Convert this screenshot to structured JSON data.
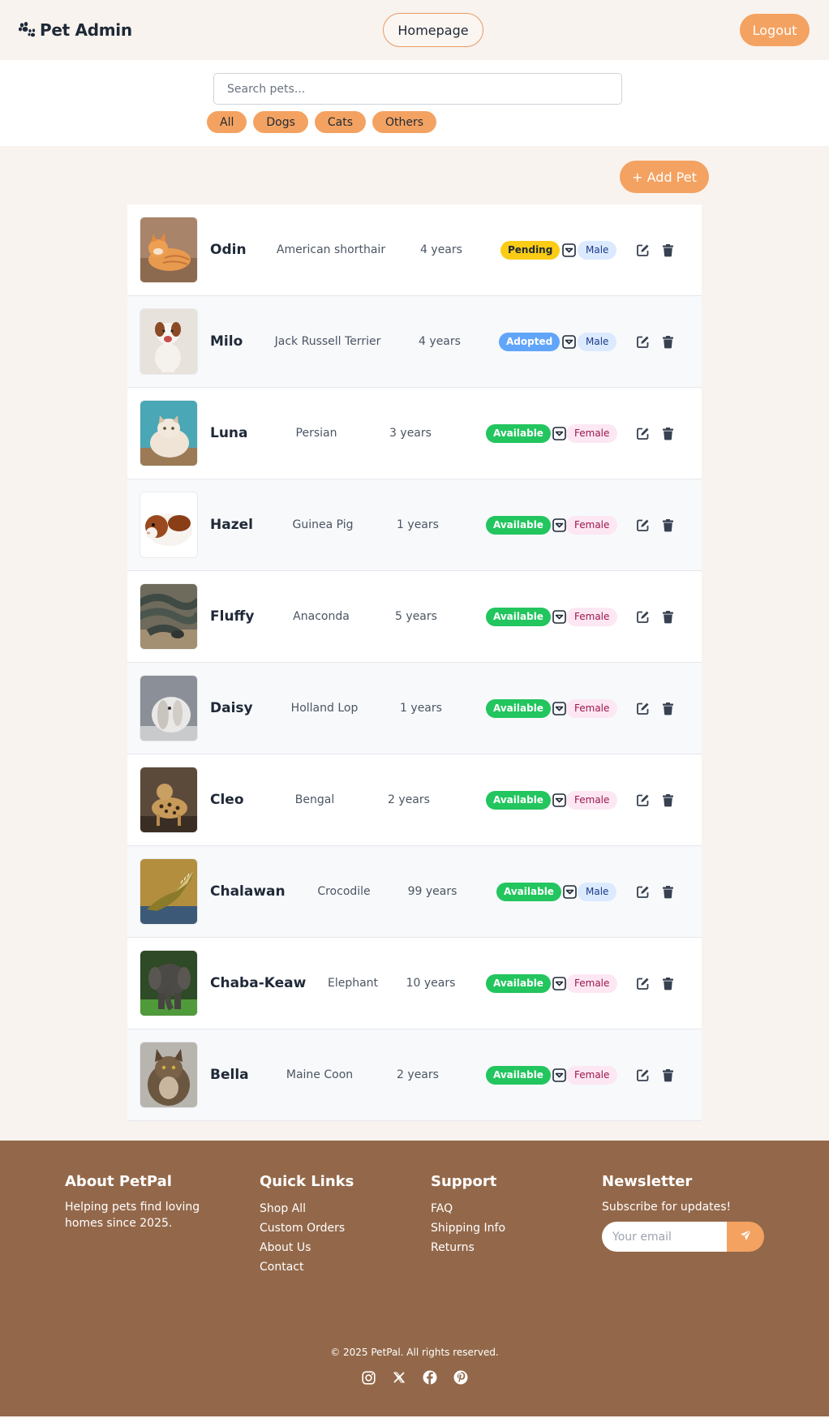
{
  "header": {
    "brand_title": "Pet Admin",
    "homepage_label": "Homepage",
    "logout_label": "Logout"
  },
  "search": {
    "placeholder": "Search pets...",
    "value": ""
  },
  "filters": [
    "All",
    "Dogs",
    "Cats",
    "Others"
  ],
  "add_pet_label": "+ Add Pet",
  "pets": [
    {
      "name": "Odin",
      "breed": "American shorthair",
      "age": "4 years",
      "status": "Pending",
      "gender": "Male"
    },
    {
      "name": "Milo",
      "breed": "Jack Russell Terrier",
      "age": "4 years",
      "status": "Adopted",
      "gender": "Male"
    },
    {
      "name": "Luna",
      "breed": "Persian",
      "age": "3 years",
      "status": "Available",
      "gender": "Female"
    },
    {
      "name": "Hazel",
      "breed": "Guinea Pig",
      "age": "1 years",
      "status": "Available",
      "gender": "Female"
    },
    {
      "name": "Fluffy",
      "breed": "Anaconda",
      "age": "5 years",
      "status": "Available",
      "gender": "Female"
    },
    {
      "name": "Daisy",
      "breed": "Holland Lop",
      "age": "1 years",
      "status": "Available",
      "gender": "Female"
    },
    {
      "name": "Cleo",
      "breed": "Bengal",
      "age": "2 years",
      "status": "Available",
      "gender": "Female"
    },
    {
      "name": "Chalawan",
      "breed": "Crocodile",
      "age": "99 years",
      "status": "Available",
      "gender": "Male"
    },
    {
      "name": "Chaba-Keaw",
      "breed": "Elephant",
      "age": "10 years",
      "status": "Available",
      "gender": "Female"
    },
    {
      "name": "Bella",
      "breed": "Maine Coon",
      "age": "2 years",
      "status": "Available",
      "gender": "Female"
    }
  ],
  "footer": {
    "about_title": "About PetPal",
    "about_text": "Helping pets find loving homes since 2025.",
    "quick_links_title": "Quick Links",
    "quick_links": [
      "Shop All",
      "Custom Orders",
      "About Us",
      "Contact"
    ],
    "support_title": "Support",
    "support_links": [
      "FAQ",
      "Shipping Info",
      "Returns"
    ],
    "newsletter_title": "Newsletter",
    "newsletter_text": "Subscribe for updates!",
    "email_placeholder": "Your email",
    "copyright": "© 2025 PetPal. All rights reserved.",
    "socials": [
      "instagram-icon",
      "x-icon",
      "facebook-icon",
      "pinterest-icon"
    ]
  },
  "colors": {
    "accent": "#f4a261",
    "footer_bg": "#93684a",
    "page_bg": "#f8f3ee",
    "pending": "#facc15",
    "adopted": "#60a5fa",
    "available": "#22c55e"
  }
}
